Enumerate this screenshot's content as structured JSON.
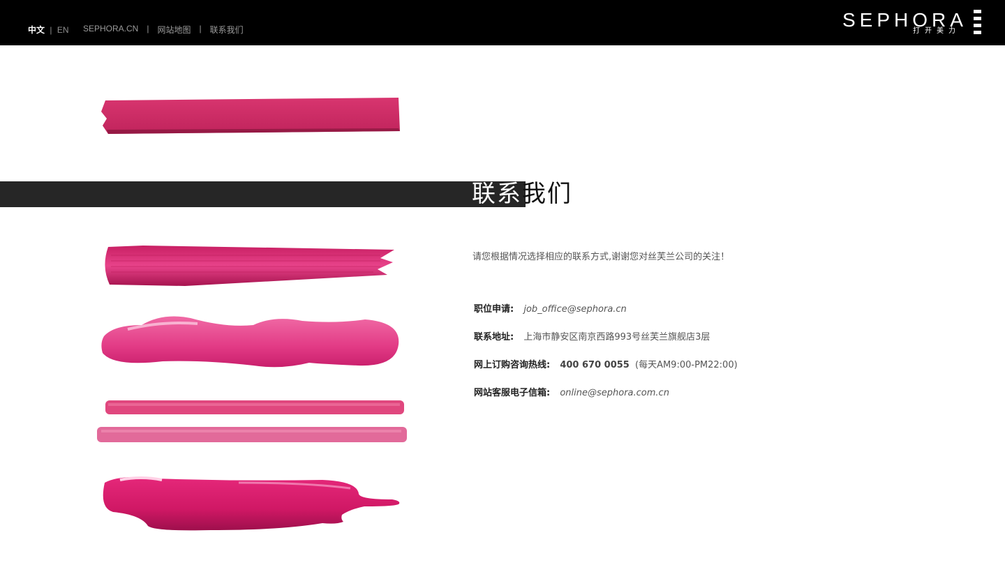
{
  "header": {
    "lang_zh": "中文",
    "lang_sep": "|",
    "lang_en": "EN",
    "nav": [
      {
        "label": "SEPHORA.CN"
      },
      {
        "label": "网站地图"
      },
      {
        "label": "联系我们"
      }
    ],
    "nav_sep": "|",
    "logo": {
      "word": "SEPHORA",
      "tagline": "打开美力"
    }
  },
  "title": {
    "part1": "联系",
    "part2": "我们"
  },
  "intro": "请您根据情况选择相应的联系方式,谢谢您对丝芙兰公司的关注！",
  "contacts": {
    "job": {
      "label": "职位申请:",
      "value": "job_office@sephora.cn"
    },
    "address": {
      "label": "联系地址:",
      "value": "上海市静安区南京西路993号丝芙兰旗舰店3层"
    },
    "hotline": {
      "label": "网上订购咨询热线:",
      "value": "400 670 0055",
      "note": "(每天AM9:00-PM22:00)"
    },
    "email": {
      "label": "网站客服电子信箱:",
      "value": "online@sephora.com.cn"
    }
  },
  "colors": {
    "header_bg": "#000000",
    "title_band": "#262626",
    "accent_pink": "#e0307a"
  },
  "icons": [
    "eyeshadow-swatch",
    "lipstick-swatch",
    "gloss-swatch",
    "pencil-swatch",
    "polish-swatch"
  ]
}
